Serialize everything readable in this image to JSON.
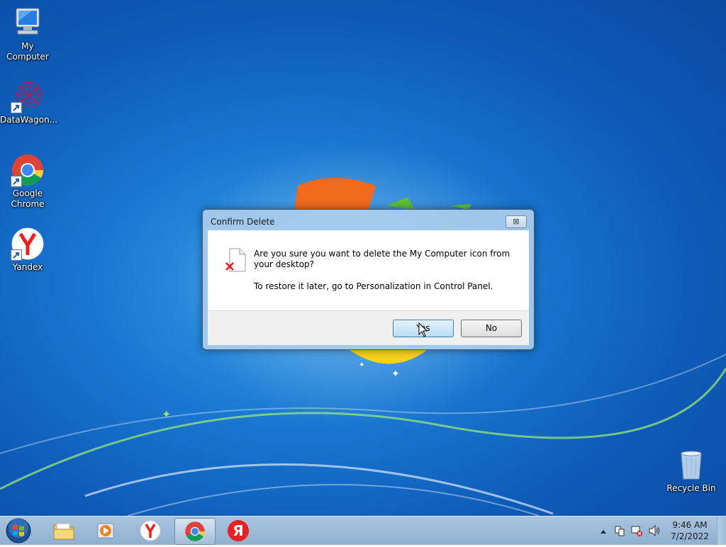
{
  "desktop": {
    "icons": [
      {
        "label": "My Computer",
        "icon": "computer-icon"
      },
      {
        "label": "DataWagon...",
        "icon": "datawagon-icon"
      },
      {
        "label": "Google Chrome",
        "icon": "chrome-icon"
      },
      {
        "label": "Yandex",
        "icon": "yandex-browser-icon"
      },
      {
        "label": "Recycle Bin",
        "icon": "recycle-bin-icon"
      }
    ]
  },
  "dialog": {
    "title": "Confirm Delete",
    "close_symbol": "⊠",
    "message": "Are you sure you want to delete the My Computer icon from your desktop?",
    "hint": "To restore it later, go to Personalization in Control Panel.",
    "yes_label": "Yes",
    "no_label": "No",
    "icon": "file-delete-icon"
  },
  "taskbar": {
    "items": [
      {
        "icon": "windows-explorer-icon"
      },
      {
        "icon": "media-player-icon"
      },
      {
        "icon": "yandex-browser-icon"
      },
      {
        "icon": "chrome-icon",
        "active": true
      },
      {
        "icon": "yandex-icon"
      }
    ],
    "clock": {
      "time": "9:46 AM",
      "date": "7/2/2022"
    }
  },
  "colors": {
    "desktop": "#1a78d2",
    "taskbar": "#a9c4de",
    "dialog_frame": "#aacdeb",
    "yandex_red": "#e82020"
  }
}
